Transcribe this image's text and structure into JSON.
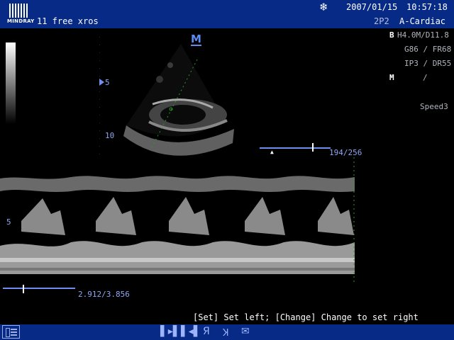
{
  "header": {
    "logo_text": "MINDRAY",
    "patient_info": "11  free xros",
    "date": "2007/01/15",
    "time": "10:57:18",
    "probe": "2P2",
    "exam": "A-Cardiac"
  },
  "params": {
    "b_mode": "B",
    "freq_depth": "H4.0M/D11.8",
    "gain_fr": "G86 / FR68",
    "ip_dr": "IP3 / DR55",
    "m_mode": "M",
    "m_sep": "/",
    "speed": "Speed3"
  },
  "image": {
    "m_marker": "M",
    "depth_5": "5",
    "depth_10": "10",
    "mmode_depth_5": "5"
  },
  "sliders": {
    "line_position": "194/256",
    "time_position": "2.912/3.856"
  },
  "status": {
    "message": "[Set] Set left; [Change] Change to set right"
  },
  "toolbar": {
    "icons": [
      "menu-icon",
      "set-left-icon",
      "set-right-icon",
      "mirror-r-icon",
      "mirror-k-icon",
      "envelope-icon"
    ]
  },
  "colors": {
    "header_bg": "#062a86",
    "accent": "#6f8ef0"
  }
}
